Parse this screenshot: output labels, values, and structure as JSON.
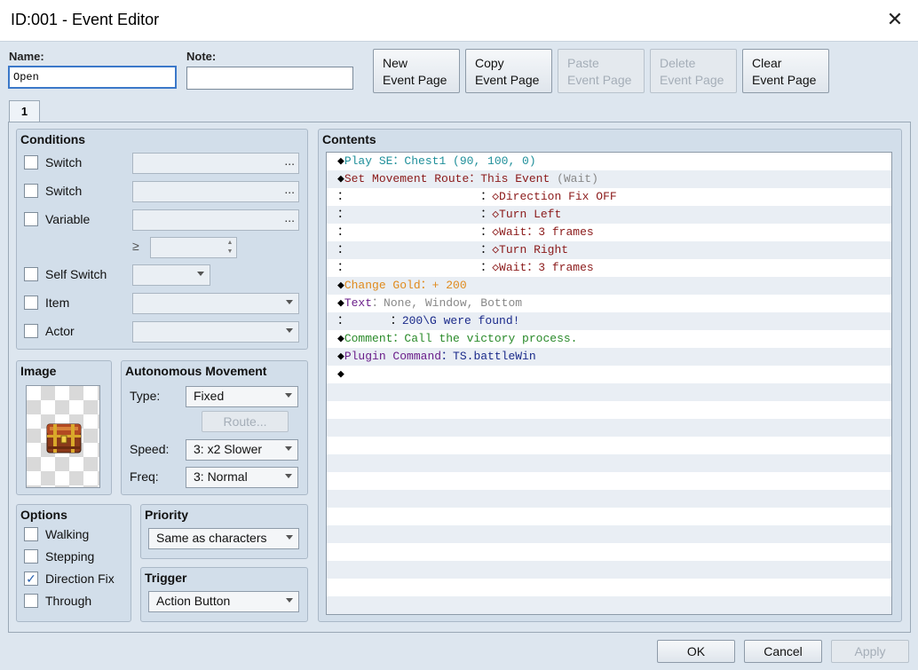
{
  "window": {
    "title": "ID:001 - Event Editor",
    "close_glyph": "✕"
  },
  "name_label": "Name:",
  "name_value": "Open",
  "note_label": "Note:",
  "note_value": "",
  "page_buttons": {
    "new": [
      "New",
      "Event Page"
    ],
    "copy": [
      "Copy",
      "Copy Event Page"
    ],
    "paste": [
      "Paste",
      "Event Page"
    ],
    "delete": [
      "Delete",
      "Event Page"
    ],
    "clear": [
      "Clear",
      "Event Page"
    ]
  },
  "tab_label": "1",
  "conditions": {
    "title": "Conditions",
    "switch1": "Switch",
    "switch2": "Switch",
    "variable": "Variable",
    "gte": "≥",
    "self_switch": "Self Switch",
    "item": "Item",
    "actor": "Actor",
    "dots": "..."
  },
  "image": {
    "title": "Image",
    "icon": "treasure-chest-icon"
  },
  "movement": {
    "title": "Autonomous Movement",
    "type_label": "Type:",
    "type_value": "Fixed",
    "route_button": "Route...",
    "speed_label": "Speed:",
    "speed_value": "3: x2 Slower",
    "freq_label": "Freq:",
    "freq_value": "3: Normal"
  },
  "options": {
    "title": "Options",
    "walking": "Walking",
    "stepping": "Stepping",
    "direction_fix": "Direction Fix",
    "direction_fix_checked": "✓",
    "through": "Through"
  },
  "priority": {
    "title": "Priority",
    "value": "Same as characters"
  },
  "trigger": {
    "title": "Trigger",
    "value": "Action Button"
  },
  "contents": {
    "title": "Contents",
    "rows": [
      [
        [
          "◆",
          "#000"
        ],
        [
          "Play SE：Chest1 (90, 100, 0)",
          "#1f8f9a"
        ]
      ],
      [
        [
          "◆",
          "#000"
        ],
        [
          "Set Movement Route：This Event ",
          "#8b1a1a"
        ],
        [
          "(Wait)",
          "#888888"
        ]
      ],
      [
        [
          "：                   ：",
          "#000"
        ],
        [
          "◇Direction Fix OFF",
          "#8b1a1a"
        ]
      ],
      [
        [
          "：                   ：",
          "#000"
        ],
        [
          "◇Turn Left",
          "#8b1a1a"
        ]
      ],
      [
        [
          "：                   ：",
          "#000"
        ],
        [
          "◇Wait：3 frames",
          "#8b1a1a"
        ]
      ],
      [
        [
          "：                   ：",
          "#000"
        ],
        [
          "◇Turn Right",
          "#8b1a1a"
        ]
      ],
      [
        [
          "：                   ：",
          "#000"
        ],
        [
          "◇Wait：3 frames",
          "#8b1a1a"
        ]
      ],
      [
        [
          "◆",
          "#000"
        ],
        [
          "Change Gold：+ 200",
          "#e08a1c"
        ]
      ],
      [
        [
          "◆",
          "#000"
        ],
        [
          "Text",
          "#6a1e8a"
        ],
        [
          "：None, Window, Bottom",
          "#888888"
        ]
      ],
      [
        [
          "：      ：",
          "#000"
        ],
        [
          "200\\G were found!",
          "#1a2a8a"
        ]
      ],
      [
        [
          "◆",
          "#000"
        ],
        [
          "Comment：Call the victory process.",
          "#2a8a2a"
        ]
      ],
      [
        [
          "◆",
          "#000"
        ],
        [
          "Plugin Command",
          "#6a1e8a"
        ],
        [
          "：TS.battleWin",
          "#1a2a8a"
        ]
      ],
      [
        [
          "◆",
          "#000"
        ]
      ]
    ],
    "total_rows": 26
  },
  "footer": {
    "ok": "OK",
    "cancel": "Cancel",
    "apply": "Apply"
  }
}
